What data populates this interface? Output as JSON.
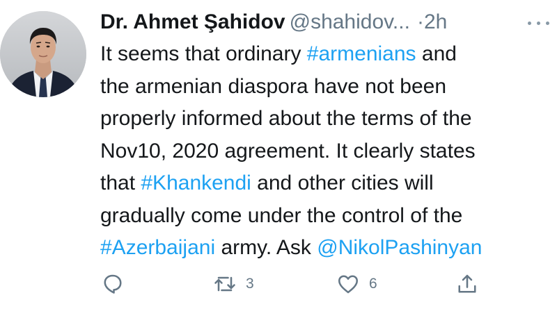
{
  "tweet": {
    "author": {
      "display_name": "Dr. Ahmet Şahidov",
      "handle": "@shahidov...",
      "time": "2h"
    },
    "body_lines": [
      [
        {
          "t": "It seems that ordinary "
        },
        {
          "t": "#armenians",
          "link": true
        },
        {
          "t": " and"
        }
      ],
      [
        {
          "t": "the armenian diaspora have not been"
        }
      ],
      [
        {
          "t": "properly informed about the terms of the"
        }
      ],
      [
        {
          "t": "Nov10, 2020 agreement. It clearly states"
        }
      ],
      [
        {
          "t": "that "
        },
        {
          "t": "#Khankendi",
          "link": true
        },
        {
          "t": " and other cities will"
        }
      ],
      [
        {
          "t": "gradually come under the control of the"
        }
      ],
      [
        {
          "t": "#Azerbaijani",
          "link": true
        },
        {
          "t": " army. Ask "
        },
        {
          "t": "@NikolPashinyan",
          "link": true
        }
      ]
    ],
    "actions": {
      "retweet_count": "3",
      "like_count": "6"
    },
    "icons": {
      "reply": "reply-icon",
      "retweet": "retweet-icon",
      "like": "like-icon",
      "share": "share-icon",
      "more": "more-icon"
    },
    "colors": {
      "link": "#1da1f2",
      "secondary": "#657786",
      "text": "#14171a"
    }
  }
}
